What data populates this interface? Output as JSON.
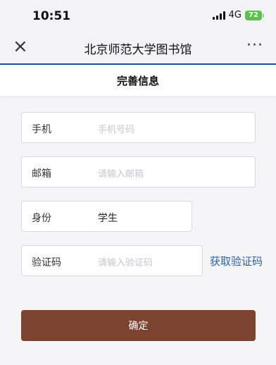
{
  "status": {
    "time": "10:51",
    "network": "4G",
    "battery": "72"
  },
  "navbar": {
    "close_symbol": "×",
    "title": "北京师范大学图书馆",
    "more_symbol": "···"
  },
  "page": {
    "title": "完善信息"
  },
  "form": {
    "phone": {
      "label": "手机",
      "placeholder": "手机号码"
    },
    "email": {
      "label": "邮箱",
      "placeholder": "请输入邮箱"
    },
    "identity": {
      "label": "身份",
      "value": "学生"
    },
    "code": {
      "label": "验证码",
      "placeholder": "请输入验证码",
      "get_code_label": "获取验证码"
    }
  },
  "confirm_label": "确定",
  "colors": {
    "accent": "#7c4330",
    "link": "#2a5fb0",
    "nav_underline": "#1f4f8f"
  }
}
